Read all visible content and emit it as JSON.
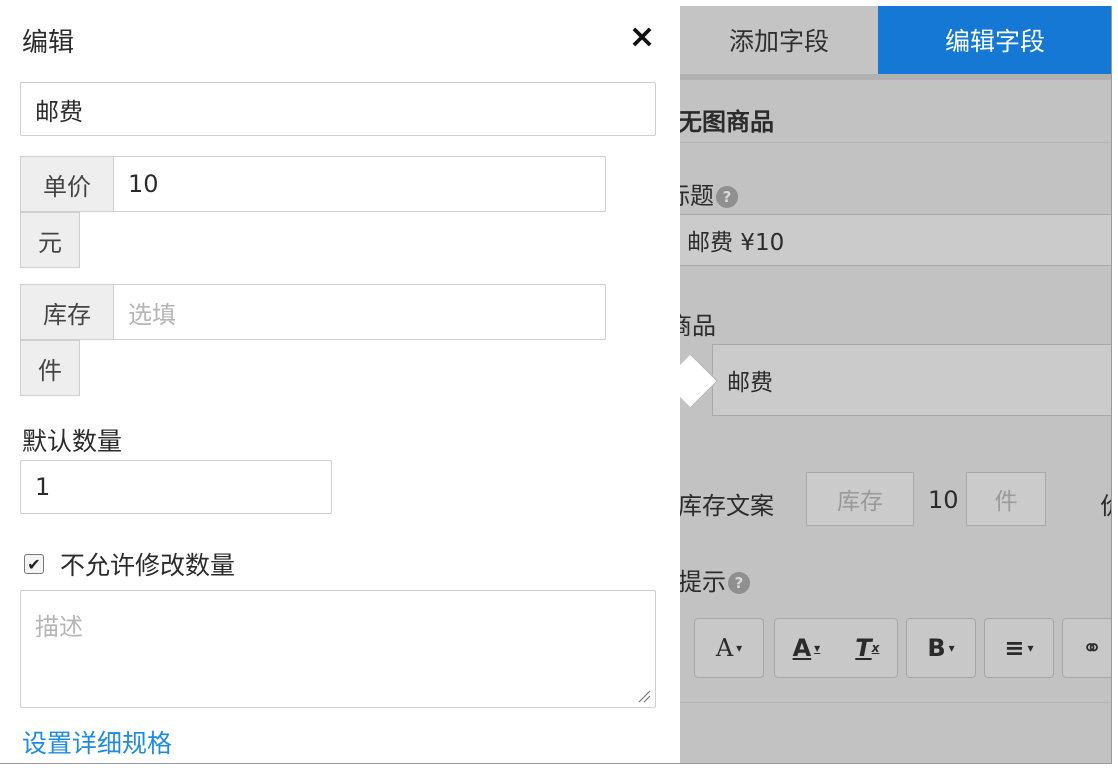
{
  "background": {
    "tabs": {
      "add_field": "添加字段",
      "edit_field": "编辑字段"
    },
    "section_title": "无图商品",
    "title_label": "标题",
    "title_value": "邮费 ¥10",
    "product_label": "商品",
    "product_value": "邮费",
    "stock_label": "库存文案",
    "stock_placeholder": "库存",
    "stock_count": "10",
    "unit_placeholder": "件",
    "cutoff_char": "价",
    "hint_label": "提示",
    "help_icon": "?",
    "toolbar": {
      "font_size": "A",
      "font_color": "A",
      "clear_format": "T",
      "bold": "B",
      "align": "≡",
      "link": "⚭"
    }
  },
  "popover": {
    "title": "编辑",
    "close": "×",
    "name_value": "邮费",
    "price_addon": "单价",
    "price_value": "10",
    "price_unit": "元",
    "stock_addon": "库存",
    "stock_placeholder": "选填",
    "stock_unit": "件",
    "default_qty_label": "默认数量",
    "default_qty_value": "1",
    "checkbox_label": "不允许修改数量",
    "checkbox_checked": true,
    "description_placeholder": "描述",
    "spec_link": "设置详细规格"
  },
  "colors": {
    "accent": "#1478d4",
    "link": "#1e8be0",
    "overlay": "#c2c2c2"
  }
}
